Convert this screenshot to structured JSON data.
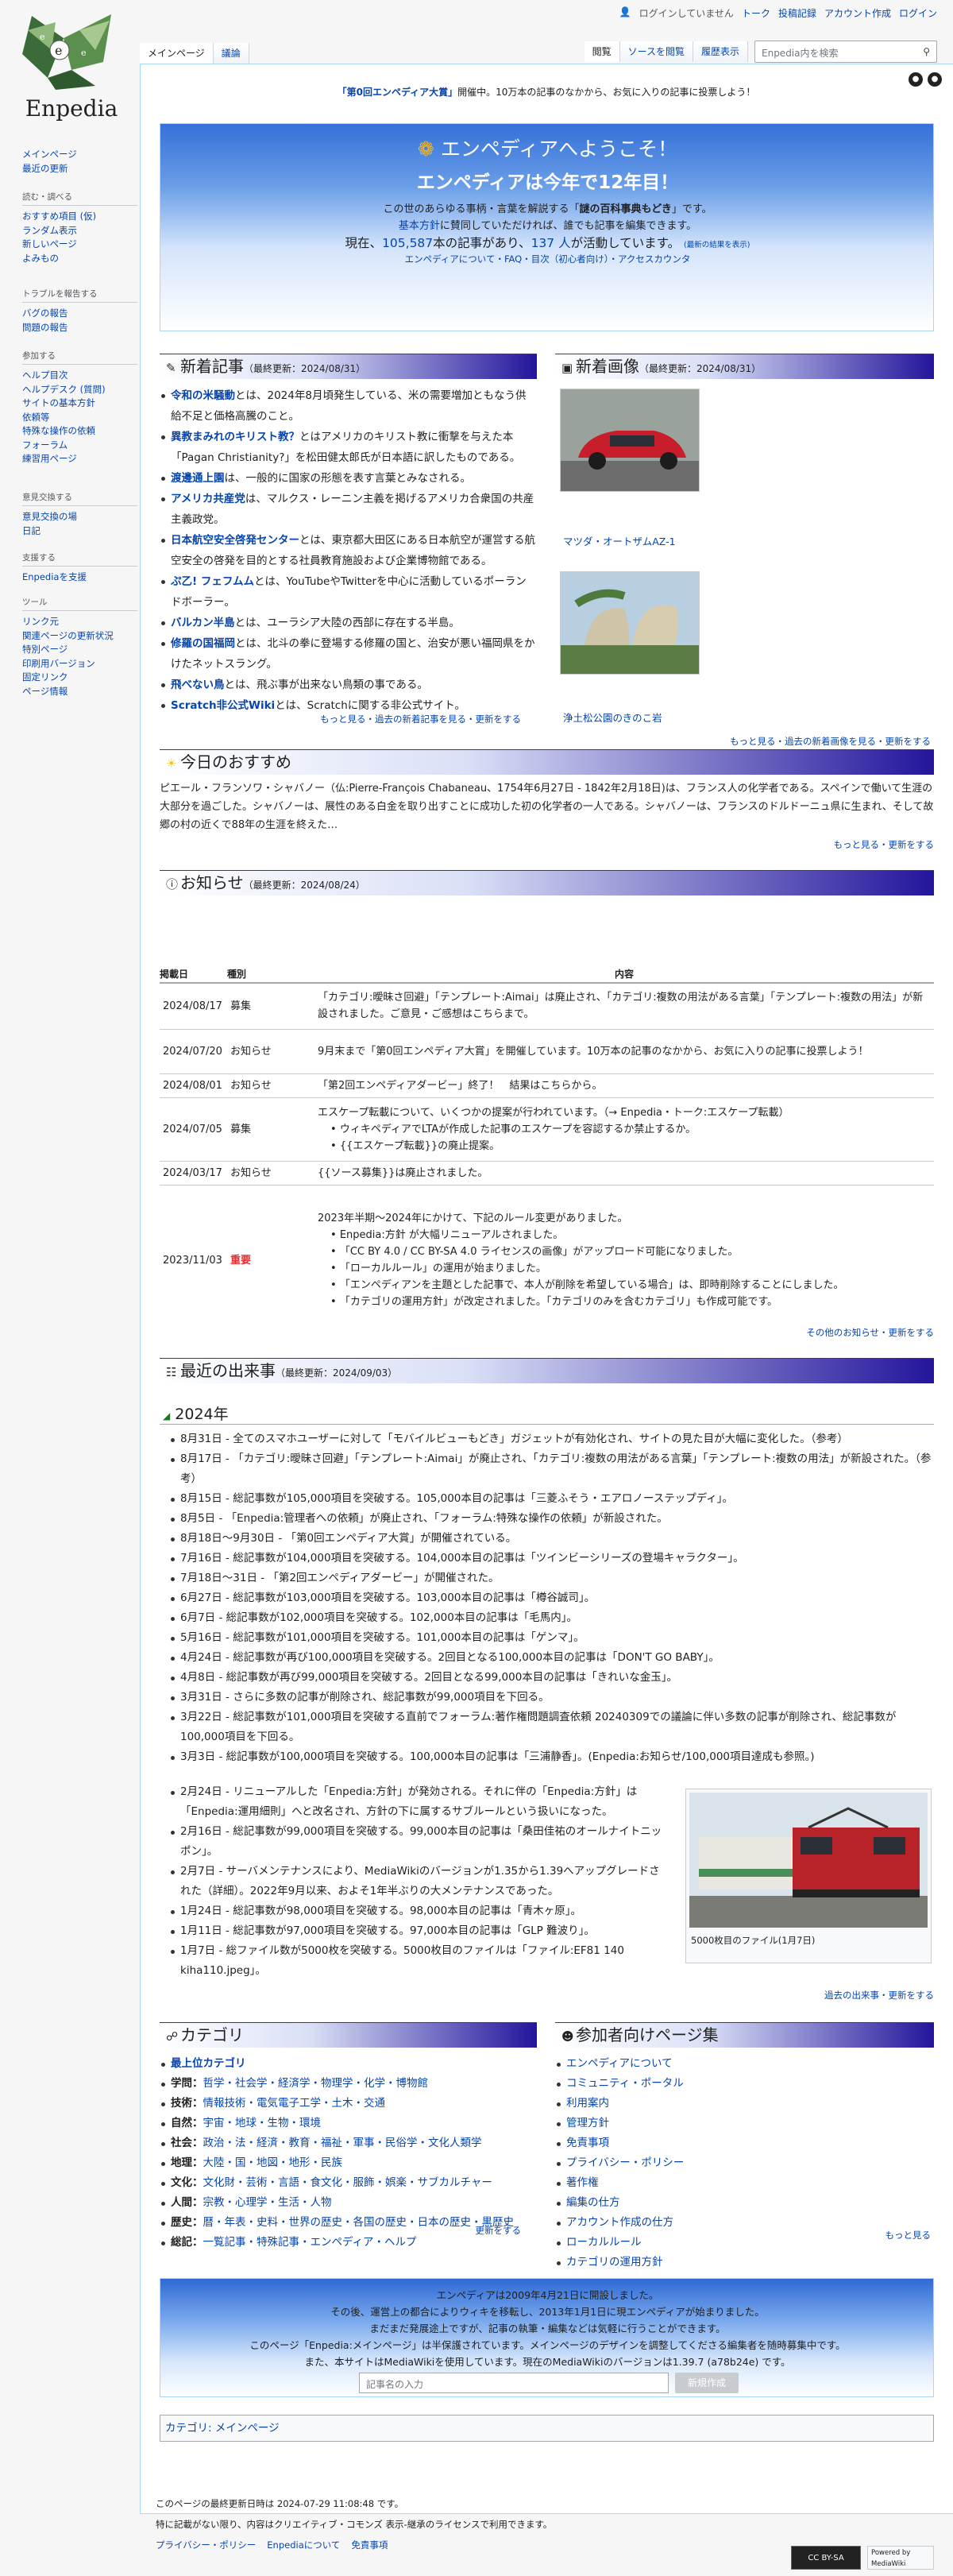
{
  "site": {
    "name": "Enpedia",
    "logo_letters": [
      "e",
      "e",
      "e"
    ]
  },
  "personal": {
    "not_logged_in": "ログインしていません",
    "talk": "トーク",
    "contribs": "投稿記録",
    "create": "アカウント作成",
    "login": "ログイン"
  },
  "tabs": {
    "main": "メインページ",
    "discussion": "議論",
    "read": "閲覧",
    "viewsource": "ソースを閲覧",
    "history": "履歴表示"
  },
  "search": {
    "placeholder": "Enpedia内を検索"
  },
  "sidebar": {
    "nav": [
      "メインページ",
      "最近の更新"
    ],
    "read": {
      "title": "読む・調べる",
      "items": [
        "おすすめ項目 (仮)",
        "ランダム表示",
        "新しいページ",
        "よみもの"
      ]
    },
    "trouble": {
      "title": "トラブルを報告する",
      "items": [
        "バグの報告",
        "問題の報告"
      ]
    },
    "join": {
      "title": "参加する",
      "items": [
        "ヘルプ目次",
        "ヘルプデスク (質問)",
        "サイトの基本方針",
        "依頼等",
        "特殊な操作の依頼",
        "フォーラム",
        "練習用ページ"
      ]
    },
    "discuss": {
      "title": "意見交換する",
      "items": [
        "意見交換の場",
        "日記"
      ]
    },
    "support": {
      "title": "支援する",
      "items": [
        "Enpediaを支援"
      ]
    },
    "tools": {
      "title": "ツール",
      "items": [
        "リンク元",
        "関連ページの更新状況",
        "特別ページ",
        "印刷用バージョン",
        "固定リンク",
        "ページ情報"
      ]
    }
  },
  "sitenotice": {
    "link": "「第0回エンペディア大賞」",
    "text": "開催中。10万本の記事のなかから、お気に入りの記事に投票しよう！"
  },
  "banner": {
    "welcome": "エンペディアへようこそ！",
    "anniv": "エンペディアは今年で12年目！",
    "l1a": "この世のあらゆる事柄・言葉を解説する「",
    "l1b": "謎の百科事典もどき",
    "l1c": "」です。",
    "l2a": "基本方針",
    "l2b": "に賛同していただければ、誰でも記事を編集できます。",
    "l3a": "現在、",
    "l3b": "105,587",
    "l3c": "本の記事があり、",
    "l3d": "137 人",
    "l3e": "が活動しています。",
    "l3f": "(最新の結果を表示)",
    "l4": "エンペディアについて・FAQ・目次（初心者向け）・アクセスカウンタ"
  },
  "sections": {
    "new_articles": {
      "title": "新着記事",
      "updated": "（最終更新：2024/08/31）"
    },
    "new_images": {
      "title": "新着画像",
      "updated": "（最終更新：2024/08/31）"
    },
    "recommend": {
      "title": "今日のおすすめ"
    },
    "notices": {
      "title": "お知らせ",
      "updated": "（最終更新：2024/08/24）"
    },
    "events": {
      "title": "最近の出来事",
      "updated": "（最終更新：2024/09/03）"
    },
    "category": {
      "title": "カテゴリ"
    },
    "participants": {
      "title": "参加者向けページ集"
    }
  },
  "new_articles": [
    {
      "link": "令和の米騒動",
      "text": "とは、2024年8月頃発生している、米の需要増加ともなう供給不足と価格高騰のこと。"
    },
    {
      "link": "異教まみれのキリスト教？",
      "text": "とはアメリカのキリスト教に衝撃を与えた本「Pagan Christianity?」を松田健太郎氏が日本語に訳したものである。"
    },
    {
      "link": "渡邊通上園",
      "text": "は、一般的に国家の形態を表す言葉とみなされる。"
    },
    {
      "link": "アメリカ共産党",
      "text": "は、マルクス・レーニン主義を掲げるアメリカ合衆国の共産主義政党。"
    },
    {
      "link": "日本航空安全啓発センター",
      "text": "とは、東京都大田区にある日本航空が運営する航空安全の啓発を目的とする社員教育施設および企業博物館である。"
    },
    {
      "link": "ぷ乙! フェフムム",
      "text": "とは、YouTubeやTwitterを中心に活動しているポーランドボーラー。"
    },
    {
      "link": "バルカン半島",
      "text": "とは、ユーラシア大陸の西部に存在する半島。"
    },
    {
      "link": "修羅の国福岡",
      "text": "とは、北斗の拳に登場する修羅の国と、治安が悪い福岡県をかけたネットスラング。"
    },
    {
      "link": "飛べない鳥",
      "text": "とは、飛ぶ事が出来ない鳥類の事である。"
    },
    {
      "link": "Scratch非公式Wiki",
      "text": "とは、Scratchに関する非公式サイト。"
    }
  ],
  "new_articles_more": "もっと見る・過去の新着記事を見る・更新をする",
  "new_images": [
    {
      "caption": "マツダ・オートザムAZ-1"
    },
    {
      "caption": "浄土松公園のきのこ岩"
    }
  ],
  "new_images_more": "もっと見る・過去の新着画像を見る・更新をする",
  "recommend": {
    "line1": "ピエール・フランソワ・シャバノー（仏:Pierre-François Chabaneau、1754年6月27日 - 1842年2月18日)は、フランス人の化学者である。スペインで働いて生涯の大部分を過ごした。シャバノーは、展性のある白金を取り出すことに成功した初の化学者の一人である。シャバノーは、フランスのドルドーニュ県に生まれ、そして故郷の村の近くで88年の生涯を終えた…",
    "more": "もっと見る・更新をする"
  },
  "notices": {
    "headers": [
      "掲載日",
      "種別",
      "内容"
    ],
    "rows": [
      {
        "date": "2024/08/17",
        "kind": "募集",
        "content": "「カテゴリ:曖昧さ回避」「テンプレート:Aimai」は廃止され、「カテゴリ:複数の用法がある言葉」「テンプレート:複数の用法」が新設されました。ご意見・ご感想はこちらまで。"
      },
      {
        "date": "2024/07/20",
        "kind": "お知らせ",
        "content": "9月末まで「第0回エンペディア大賞」を開催しています。10万本の記事のなかから、お気に入りの記事に投票しよう！"
      },
      {
        "date": "2024/08/01",
        "kind": "お知らせ",
        "content": "「第2回エンペディアダービー」終了！　結果はこちらから。"
      },
      {
        "date": "2024/07/05",
        "kind": "募集",
        "content": "エスケープ転載について、いくつかの提案が行われています。（→ Enpedia・トーク:エスケープ転載）",
        "bullets": [
          "ウィキペディアでLTAが作成した記事のエスケープを容認するか禁止するか。",
          "{{エスケープ転載}}の廃止提案。"
        ]
      },
      {
        "date": "2024/03/17",
        "kind": "お知らせ",
        "content": "{{ソース募集}}は廃止されました。"
      },
      {
        "date": "2023/11/03",
        "kind": "重要",
        "content": "2023年半期〜2024年にかけて、下記のルール変更がありました。",
        "bullets": [
          "Enpedia:方針 が大幅リニューアルされました。",
          "「CC BY 4.0 / CC BY-SA 4.0 ライセンスの画像」がアップロード可能になりました。",
          "「ローカルルール」の運用が始まりました。",
          "「エンペディアンを主題とした記事で、本人が削除を希望している場合」は、即時削除することにしました。",
          "「カテゴリの運用方針」が改定されました。「カテゴリのみを含むカテゴリ」も作成可能です。"
        ]
      }
    ],
    "more": "その他のお知らせ・更新をする"
  },
  "events": {
    "year": "2024年",
    "items": [
      "8月31日 - 全てのスマホユーザーに対して「モバイルビューもどき」ガジェットが有効化され、サイトの見た目が大幅に変化した。（参考）",
      "8月17日 - 「カテゴリ:曖昧さ回避」「テンプレート:Aimai」が廃止され、「カテゴリ:複数の用法がある言葉」「テンプレート:複数の用法」が新設された。（参考）",
      "8月15日 - 総記事数が105,000項目を突破する。105,000本目の記事は「三菱ふそう・エアロノーステップディ」。",
      "8月5日 - 「Enpedia:管理者への依頼」が廃止され、「フォーラム:特殊な操作の依頼」が新設された。",
      "8月18日〜9月30日 - 「第0回エンペディア大賞」が開催されている。",
      "7月16日 - 総記事数が104,000項目を突破する。104,000本目の記事は「ツインビーシリーズの登場キャラクター」。",
      "7月18日〜31日 - 「第2回エンペディアダービー」が開催された。",
      "6月27日 - 総記事数が103,000項目を突破する。103,000本目の記事は「樽谷誠司」。",
      "6月7日 - 総記事数が102,000項目を突破する。102,000本目の記事は「毛馬内」。",
      "5月16日 - 総記事数が101,000項目を突破する。101,000本目の記事は「ゲンマ」。",
      "4月24日 - 総記事数が再び100,000項目を突破する。2回目となる100,000本目の記事は「DON'T GO BABY」。",
      "4月8日 - 総記事数が再び99,000項目を突破する。2回目となる99,000本目の記事は「きれいな金玉」。",
      "3月31日 - さらに多数の記事が削除され、総記事数が99,000項目を下回る。",
      "3月22日 - 総記事数が101,000項目を突破する直前でフォーラム:著作権問題調査依頼 20240309での議論に伴い多数の記事が削除され、総記事数が100,000項目を下回る。",
      "3月3日 - 総記事数が100,000項目を突破する。100,000本目の記事は「三浦静香」。(Enpedia:お知らせ/100,000項目達成も参照。)"
    ],
    "items2": [
      "2月24日 - リニューアルした「Enpedia:方針」が発効される。それに伴の「Enpedia:方針」は「Enpedia:運用細則」へと改名され、方針の下に属するサブルールという扱いになった。",
      "2月16日 - 総記事数が99,000項目を突破する。99,000本目の記事は「桑田佳祐のオールナイトニッポン」。",
      "2月7日 - サーバメンテナンスにより、MediaWikiのバージョンが1.35から1.39へアップグレードされた（詳細）。2022年9月以来、およそ1年半ぶりの大メンテナンスであった。",
      "1月24日 - 総記事数が98,000項目を突破する。98,000本目の記事は「青木ヶ原」。",
      "1月11日 - 総記事数が97,000項目を突破する。97,000本目の記事は「GLP 難波り」。",
      "1月7日 - 総ファイル数が5000枚を突破する。5000枚目のファイルは「ファイル:EF81 140 kiha110.jpeg」。"
    ],
    "image_caption": "5000枚目のファイル(1月7日)",
    "more": "過去の出来事・更新をする"
  },
  "categories": [
    {
      "head": "最上位カテゴリ",
      "items": ""
    },
    {
      "head": "学問：",
      "items": "哲学・社会学・経済学・物理学・化学・博物館"
    },
    {
      "head": "技術：",
      "items": "情報技術・電気電子工学・土木・交通"
    },
    {
      "head": "自然：",
      "items": "宇宙・地球・生物・環境"
    },
    {
      "head": "社会：",
      "items": "政治・法・経済・教育・福祉・軍事・民俗学・文化人類学"
    },
    {
      "head": "地理：",
      "items": "大陸・国・地図・地形・民族"
    },
    {
      "head": "文化：",
      "items": "文化財・芸術・言語・食文化・服飾・娯楽・サブカルチャー"
    },
    {
      "head": "人間：",
      "items": "宗教・心理学・生活・人物"
    },
    {
      "head": "歴史：",
      "items": "暦・年表・史料・世界の歴史・各国の歴史・日本の歴史・黒歴史"
    },
    {
      "head": "総記：",
      "items": "一覧記事・特殊記事・エンペディア・ヘルプ"
    }
  ],
  "categories_more": "更新をする",
  "participant_pages": [
    "エンペディアについて",
    "コミュニティ・ポータル",
    "利用案内",
    "管理方針",
    "免責事項",
    "プライバシー・ポリシー",
    "著作権",
    "編集の仕方",
    "アカウント作成の仕方",
    "ローカルルール",
    "カテゴリの運用方針"
  ],
  "participant_more": "もっと見る",
  "footerbox": {
    "l1": "エンペディアは2009年4月21日に開設しました。",
    "l2": "その後、運営上の都合によりウィキを移転し、2013年1月1日に現エンペディアが始まりました。",
    "l3": "まだまだ発展途上ですが、記事の執筆・編集などは気軽に行うことができます。",
    "l4": "このページ「Enpedia:メインページ」は半保護されています。メインページのデザインを調整してくださる編集者を随時募集中です。",
    "l5": "また、本サイトはMediaWikiを使用しています。現在のMediaWikiのバージョンは1.39.7 (a78b24e) です。",
    "input_placeholder": "記事名の入力",
    "button": "新規作成"
  },
  "catbar": {
    "label": "カテゴリ:",
    "value": "メインページ"
  },
  "pagefoot": {
    "modified": "このページの最終更新日時は 2024-07-29 11:08:48 です。",
    "license": "特に記載がない限り、内容はクリエイティブ・コモンズ 表示-継承のライセンスで利用できます。",
    "links": [
      "プライバシー・ポリシー",
      "Enpediaについて",
      "免責事項"
    ],
    "badge1": "CC BY-SA",
    "badge2": "Powered by MediaWiki"
  }
}
